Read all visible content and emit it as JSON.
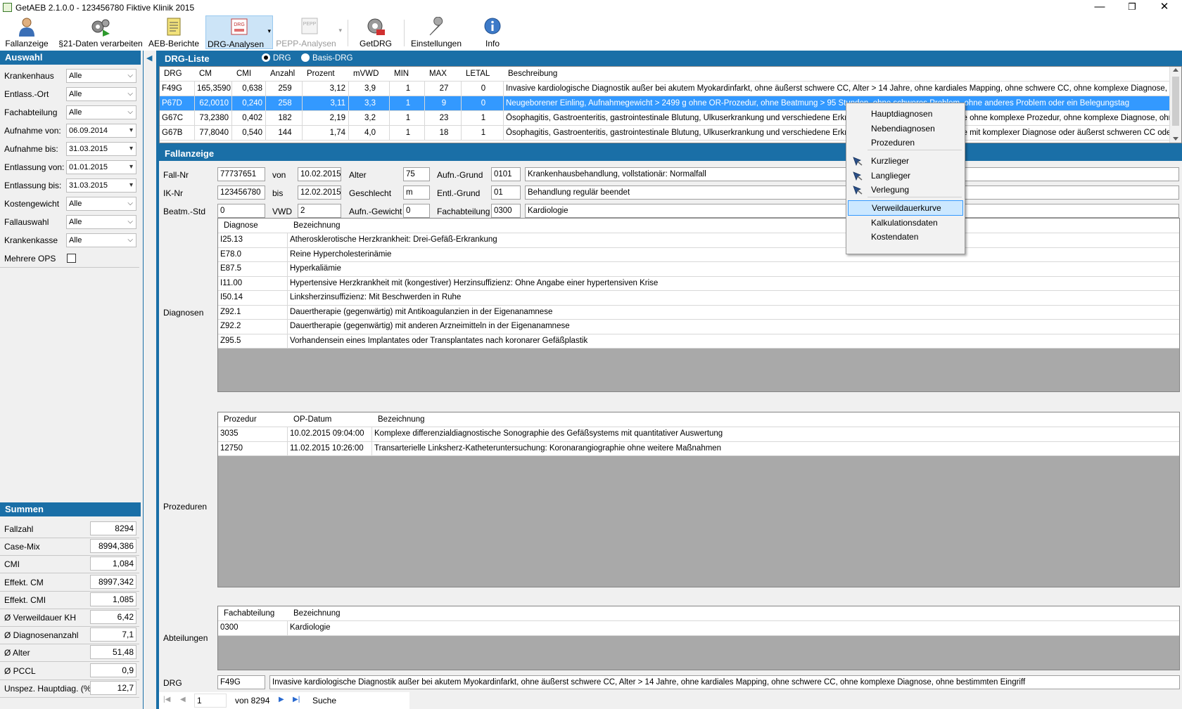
{
  "window": {
    "title": "GetAEB 2.1.0.0 - 123456780 Fiktive Klinik 2015",
    "min": "—",
    "max": "❐",
    "close": "✕"
  },
  "toolbar": {
    "items": [
      {
        "label": "Fallanzeige",
        "icon": "person-icon"
      },
      {
        "label": "§21-Daten verarbeiten",
        "icon": "gears-icon"
      },
      {
        "label": "AEB-Berichte",
        "icon": "document-icon"
      },
      {
        "label": "DRG-Analysen",
        "icon": "drg-icon"
      },
      {
        "label": "PEPP-Analysen",
        "icon": "pepp-icon"
      },
      {
        "label": "GetDRG",
        "icon": "getdrg-icon"
      },
      {
        "label": "Einstellungen",
        "icon": "wrench-icon"
      },
      {
        "label": "Info",
        "icon": "info-icon"
      }
    ],
    "dropdown_arrow": "▾"
  },
  "auswahl": {
    "title": "Auswahl",
    "filters": [
      {
        "label": "Krankenhaus",
        "value": "Alle",
        "type": "combo"
      },
      {
        "label": "Entlass.-Ort",
        "value": "Alle",
        "type": "combo"
      },
      {
        "label": "Fachabteilung",
        "value": "Alle",
        "type": "combo"
      },
      {
        "label": "Aufnahme von:",
        "value": "06.09.2014",
        "type": "date"
      },
      {
        "label": "Aufnahme bis:",
        "value": "31.03.2015",
        "type": "date"
      },
      {
        "label": "Entlassung von:",
        "value": "01.01.2015",
        "type": "date"
      },
      {
        "label": "Entlassung bis:",
        "value": "31.03.2015",
        "type": "date"
      },
      {
        "label": "Kostengewicht",
        "value": "Alle",
        "type": "combo"
      },
      {
        "label": "Fallauswahl",
        "value": "Alle",
        "type": "combo"
      },
      {
        "label": "Krankenkasse",
        "value": "Alle",
        "type": "combo"
      },
      {
        "label": "Mehrere OPS",
        "value": "",
        "type": "check"
      }
    ],
    "combo_arrow": "⌵",
    "date_arrow": "▾"
  },
  "summen": {
    "title": "Summen",
    "rows": [
      {
        "label": "Fallzahl",
        "value": "8294"
      },
      {
        "label": "Case-Mix",
        "value": "8994,386"
      },
      {
        "label": "CMI",
        "value": "1,084"
      },
      {
        "label": "Effekt. CM",
        "value": "8997,342"
      },
      {
        "label": "Effekt. CMI",
        "value": "1,085"
      },
      {
        "label": "Ø Verweildauer KH",
        "value": "6,42"
      },
      {
        "label": "Ø Diagnosenanzahl",
        "value": "7,1"
      },
      {
        "label": "Ø Alter",
        "value": "51,48"
      },
      {
        "label": "Ø PCCL",
        "value": "0,9"
      },
      {
        "label": "Unspez. Hauptdiag. (%)",
        "value": "12,7"
      }
    ]
  },
  "collapse_arrow": "◀",
  "drg_liste": {
    "title": "DRG-Liste",
    "radio_drg": "DRG",
    "radio_basis": "Basis-DRG",
    "columns": [
      "DRG",
      "CM",
      "CMI",
      "Anzahl",
      "Prozent",
      "mVWD",
      "MIN",
      "MAX",
      "LETAL",
      "Beschreibung"
    ],
    "rows": [
      [
        "F49G",
        "165,3590",
        "0,638",
        "259",
        "3,12",
        "3,9",
        "1",
        "27",
        "0",
        "Invasive kardiologische Diagnostik außer bei akutem Myokardinfarkt, ohne äußerst schwere CC, Alter > 14 Jahre, ohne kardiales Mapping, ohne schwere CC, ohne komplexe Diagnose, oh..."
      ],
      [
        "P67D",
        "62,0010",
        "0,240",
        "258",
        "3,11",
        "3,3",
        "1",
        "9",
        "0",
        "Neugeborener Einling, Aufnahmegewicht > 2499 g ohne OR-Prozedur, ohne Beatmung > 95 Stunden, ohne schweres Problem, ohne anderes Problem oder ein Belegungstag"
      ],
      [
        "G67C",
        "73,2380",
        "0,402",
        "182",
        "2,19",
        "3,2",
        "1",
        "23",
        "1",
        "Ösophagitis, Gastroenteritis, gastrointestinale Blutung, Ulkuserkrankung und verschiedene Erkrankungen der Verdauungsorgane ohne komplexe Prozedur, ohne komplexe Diagnose, ohne ..."
      ],
      [
        "G67B",
        "77,8040",
        "0,540",
        "144",
        "1,74",
        "4,0",
        "1",
        "18",
        "1",
        "Ösophagitis, Gastroenteritis, gastrointestinale Blutung, Ulkuserkrankung und verschiedene Erkrankungen der Verdauungsorgane mit komplexer Diagnose oder äußerst schweren CC oder Alt..."
      ]
    ]
  },
  "fallanzeige": {
    "title": "Fallanzeige",
    "fall_nr_label": "Fall-Nr",
    "fall_nr": "77737651",
    "von_label": "von",
    "von": "10.02.2015",
    "alter_label": "Alter",
    "alter": "75",
    "aufn_grund_label": "Aufn.-Grund",
    "aufn_grund": "0101",
    "aufn_grund_text": "Krankenhausbehandlung, vollstationär: Normalfall",
    "ik_nr_label": "IK-Nr",
    "ik_nr": "123456780",
    "bis_label": "bis",
    "bis": "12.02.2015",
    "geschlecht_label": "Geschlecht",
    "geschlecht": "m",
    "entl_grund_label": "Entl.-Grund",
    "entl_grund": "01",
    "entl_grund_text": "Behandlung regulär beendet",
    "beatm_label": "Beatm.-Std",
    "beatm": "0",
    "vwd_label": "VWD",
    "vwd": "2",
    "aufn_gewicht_label": "Aufn.-Gewicht",
    "aufn_gewicht": "0",
    "fachabteilung_label": "Fachabteilung",
    "fachabteilung": "0300",
    "fachabteilung_text": "Kardiologie",
    "diagnosen_label": "Diagnosen",
    "diagnosen_columns": [
      "Diagnose",
      "Bezeichnung"
    ],
    "diagnosen": [
      [
        "I25.13",
        "Atherosklerotische Herzkrankheit: Drei-Gefäß-Erkrankung"
      ],
      [
        "E78.0",
        "Reine Hypercholesterinämie"
      ],
      [
        "E87.5",
        "Hyperkaliämie"
      ],
      [
        "I11.00",
        "Hypertensive Herzkrankheit mit (kongestiver) Herzinsuffizienz: Ohne Angabe einer hypertensiven Krise"
      ],
      [
        "I50.14",
        "Linksherzinsuffizienz: Mit Beschwerden in Ruhe"
      ],
      [
        "Z92.1",
        "Dauertherapie (gegenwärtig) mit Antikoagulanzien in der Eigenanamnese"
      ],
      [
        "Z92.2",
        "Dauertherapie (gegenwärtig) mit anderen Arzneimitteln in der Eigenanamnese"
      ],
      [
        "Z95.5",
        "Vorhandensein eines Implantates oder Transplantates nach koronarer Gefäßplastik"
      ]
    ],
    "prozeduren_label": "Prozeduren",
    "prozeduren_columns": [
      "Prozedur",
      "OP-Datum",
      "Bezeichnung"
    ],
    "prozeduren": [
      [
        "3035",
        "10.02.2015 09:04:00",
        "Komplexe differenzialdiagnostische Sonographie des Gefäßsystems mit quantitativer Auswertung"
      ],
      [
        "12750",
        "11.02.2015 10:26:00",
        "Transarterielle Linksherz-Katheteruntersuchung: Koronarangiographie ohne weitere Maßnahmen"
      ]
    ],
    "abteilungen_label": "Abteilungen",
    "abteilungen_columns": [
      "Fachabteilung",
      "Bezeichnung"
    ],
    "abteilungen": [
      [
        "0300",
        "Kardiologie"
      ]
    ],
    "drg_label": "DRG",
    "drg": "F49G",
    "drg_text": "Invasive kardiologische Diagnostik außer bei akutem Myokardinfarkt, ohne äußerst schwere CC, Alter > 14 Jahre, ohne kardiales Mapping, ohne schwere CC, ohne komplexe Diagnose, ohne bestimmten Eingriff"
  },
  "navigator": {
    "first": "|◀",
    "prev": "◀",
    "position": "1",
    "of": "von 8294",
    "next": "▶",
    "last": "▶|",
    "search": "Suche"
  },
  "context_menu": {
    "items": [
      {
        "label": "Hauptdiagnosen",
        "icon": ""
      },
      {
        "label": "Nebendiagnosen",
        "icon": ""
      },
      {
        "label": "Prozeduren",
        "icon": ""
      },
      {
        "label": "Kurzlieger",
        "icon": "pen-icon"
      },
      {
        "label": "Langlieger",
        "icon": "pen-icon"
      },
      {
        "label": "Verlegung",
        "icon": "pen-icon"
      },
      {
        "label": "Verweildauerkurve",
        "icon": ""
      },
      {
        "label": "Kalkulationsdaten",
        "icon": ""
      },
      {
        "label": "Kostendaten",
        "icon": ""
      }
    ]
  }
}
